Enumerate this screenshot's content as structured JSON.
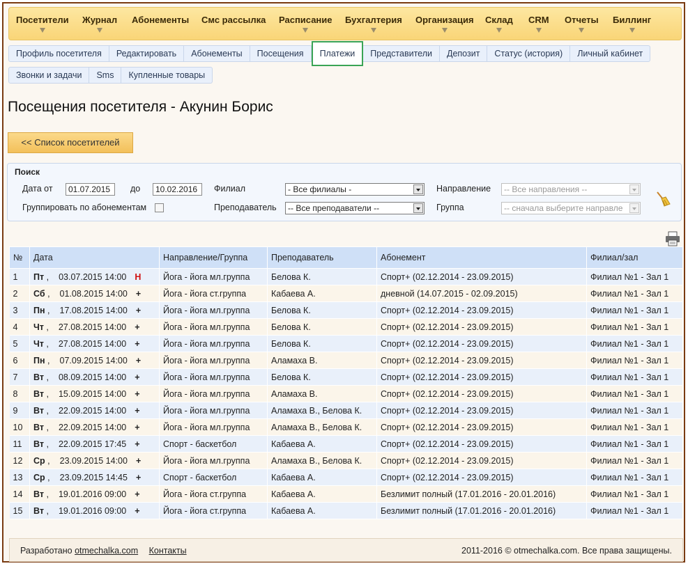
{
  "top_menu": [
    "Посетители",
    "Журнал",
    "Абонементы",
    "Смс рассылка",
    "Расписание",
    "Бухгалтерия",
    "Организация",
    "Склад",
    "CRM",
    "Отчеты",
    "Биллинг"
  ],
  "tabs_row1": [
    "Профиль посетителя",
    "Редактировать",
    "Абонементы",
    "Посещения",
    "Платежи",
    "Представители",
    "Депозит",
    "Статус (история)",
    "Личный кабинет"
  ],
  "tabs_row2": [
    "Звонки и задачи",
    "Sms",
    "Купленные товары"
  ],
  "page_title": "Посещения посетителя - Акунин Борис",
  "back_button": "<< Список посетителей",
  "search": {
    "title": "Поиск",
    "date_from_label": "Дата от",
    "date_from_value": "01.07.2015",
    "date_to_label": "до",
    "date_to_value": "10.02.2016",
    "group_label": "Группировать по абонементам",
    "branch_label": "Филиал",
    "branch_value": "- Все филиалы -",
    "teacher_label": "Преподаватель",
    "teacher_value": "-- Все преподаватели --",
    "direction_label": "Направление",
    "direction_value": "-- Все направления --",
    "group2_label": "Группа",
    "group2_value": "-- сначала выберите направле"
  },
  "table": {
    "headers": [
      "№",
      "Дата",
      "Направление/Группа",
      "Преподаватель",
      "Абонемент",
      "Филиал/зал"
    ],
    "rows": [
      {
        "n": "1",
        "dow": "Пт",
        "date": "03.07.2015 14:00",
        "mark": "Н",
        "group": "Йога - йога мл.группа",
        "teacher": "Белова К.",
        "sub": "Спорт+ (02.12.2014 - 23.09.2015)",
        "hall": "Филиал №1 - Зал 1"
      },
      {
        "n": "2",
        "dow": "Сб",
        "date": "01.08.2015 14:00",
        "mark": "+",
        "group": "Йога - йога ст.группа",
        "teacher": "Кабаева А.",
        "sub": "дневной (14.07.2015 - 02.09.2015)",
        "hall": "Филиал №1 - Зал 1"
      },
      {
        "n": "3",
        "dow": "Пн",
        "date": "17.08.2015 14:00",
        "mark": "+",
        "group": "Йога - йога мл.группа",
        "teacher": "Белова К.",
        "sub": "Спорт+ (02.12.2014 - 23.09.2015)",
        "hall": "Филиал №1 - Зал 1"
      },
      {
        "n": "4",
        "dow": "Чт",
        "date": "27.08.2015 14:00",
        "mark": "+",
        "group": "Йога - йога мл.группа",
        "teacher": "Белова К.",
        "sub": "Спорт+ (02.12.2014 - 23.09.2015)",
        "hall": "Филиал №1 - Зал 1"
      },
      {
        "n": "5",
        "dow": "Чт",
        "date": "27.08.2015 14:00",
        "mark": "+",
        "group": "Йога - йога мл.группа",
        "teacher": "Белова К.",
        "sub": "Спорт+ (02.12.2014 - 23.09.2015)",
        "hall": "Филиал №1 - Зал 1"
      },
      {
        "n": "6",
        "dow": "Пн",
        "date": "07.09.2015 14:00",
        "mark": "+",
        "group": "Йога - йога мл.группа",
        "teacher": "Аламаха В.",
        "sub": "Спорт+ (02.12.2014 - 23.09.2015)",
        "hall": "Филиал №1 - Зал 1"
      },
      {
        "n": "7",
        "dow": "Вт",
        "date": "08.09.2015 14:00",
        "mark": "+",
        "group": "Йога - йога мл.группа",
        "teacher": "Белова К.",
        "sub": "Спорт+ (02.12.2014 - 23.09.2015)",
        "hall": "Филиал №1 - Зал 1"
      },
      {
        "n": "8",
        "dow": "Вт",
        "date": "15.09.2015 14:00",
        "mark": "+",
        "group": "Йога - йога мл.группа",
        "teacher": "Аламаха В.",
        "sub": "Спорт+ (02.12.2014 - 23.09.2015)",
        "hall": "Филиал №1 - Зал 1"
      },
      {
        "n": "9",
        "dow": "Вт",
        "date": "22.09.2015 14:00",
        "mark": "+",
        "group": "Йога - йога мл.группа",
        "teacher": "Аламаха В., Белова К.",
        "sub": "Спорт+ (02.12.2014 - 23.09.2015)",
        "hall": "Филиал №1 - Зал 1"
      },
      {
        "n": "10",
        "dow": "Вт",
        "date": "22.09.2015 14:00",
        "mark": "+",
        "group": "Йога - йога мл.группа",
        "teacher": "Аламаха В., Белова К.",
        "sub": "Спорт+ (02.12.2014 - 23.09.2015)",
        "hall": "Филиал №1 - Зал 1"
      },
      {
        "n": "11",
        "dow": "Вт",
        "date": "22.09.2015 17:45",
        "mark": "+",
        "group": "Спорт - баскетбол",
        "teacher": "Кабаева А.",
        "sub": "Спорт+ (02.12.2014 - 23.09.2015)",
        "hall": "Филиал №1 - Зал 1"
      },
      {
        "n": "12",
        "dow": "Ср",
        "date": "23.09.2015 14:00",
        "mark": "+",
        "group": "Йога - йога мл.группа",
        "teacher": "Аламаха В., Белова К.",
        "sub": "Спорт+ (02.12.2014 - 23.09.2015)",
        "hall": "Филиал №1 - Зал 1"
      },
      {
        "n": "13",
        "dow": "Ср",
        "date": "23.09.2015 14:45",
        "mark": "+",
        "group": "Спорт - баскетбол",
        "teacher": "Кабаева А.",
        "sub": "Спорт+ (02.12.2014 - 23.09.2015)",
        "hall": "Филиал №1 - Зал 1"
      },
      {
        "n": "14",
        "dow": "Вт",
        "date": "19.01.2016 09:00",
        "mark": "+",
        "group": "Йога - йога ст.группа",
        "teacher": "Кабаева А.",
        "sub": "Безлимит полный (17.01.2016 - 20.01.2016)",
        "hall": "Филиал №1 - Зал 1"
      },
      {
        "n": "15",
        "dow": "Вт",
        "date": "19.01.2016 09:00",
        "mark": "+",
        "group": "Йога - йога ст.группа",
        "teacher": "Кабаева А.",
        "sub": "Безлимит полный (17.01.2016 - 20.01.2016)",
        "hall": "Филиал №1 - Зал 1"
      }
    ]
  },
  "footer": {
    "developed": "Разработано",
    "dev_link": "otmechalka.com",
    "contacts": "Контакты",
    "copyright": "2011-2016 © otmechalka.com. Все права защищены."
  },
  "colors": {
    "frame": "#7a3b12",
    "menu_bg": "#f9d577",
    "tab_bg": "#e9f0fb",
    "active_tab_border": "#3aa455",
    "header_bg": "#cfe0f7",
    "row_blue": "#e9f0fa",
    "row_beige": "#fbf5ea",
    "absent_mark": "#d01010"
  }
}
